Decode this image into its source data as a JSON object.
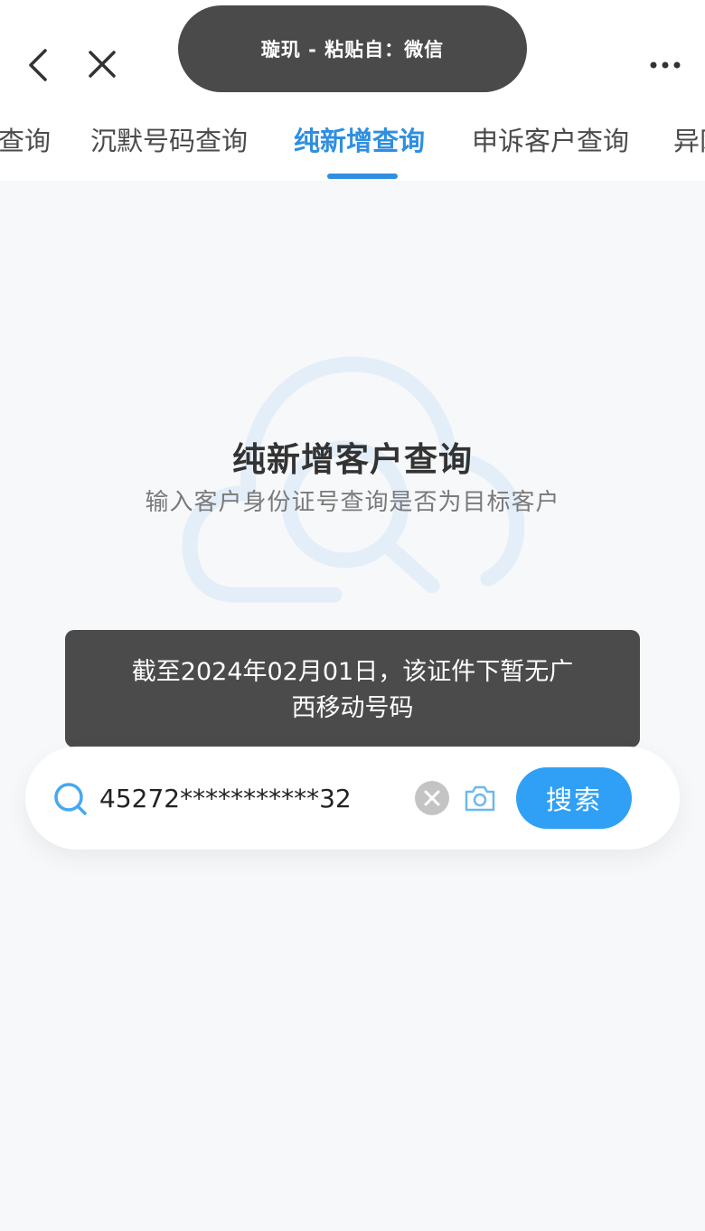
{
  "paste_toast": {
    "text": "璇玑 - 粘贴自：微信"
  },
  "nav": {
    "back_icon": "chevron-left-icon",
    "close_icon": "close-icon",
    "more_icon": "more-horizontal-icon"
  },
  "tabs": [
    {
      "label": "查询",
      "active": false
    },
    {
      "label": "沉默号码查询",
      "active": false
    },
    {
      "label": "纯新增查询",
      "active": true
    },
    {
      "label": "申诉客户查询",
      "active": false
    },
    {
      "label": "异网",
      "active": false
    }
  ],
  "hero": {
    "title": "纯新增客户查询",
    "subtitle": "输入客户身份证号查询是否为目标客户",
    "illustration_icon": "cloud-search-icon"
  },
  "result_toast": {
    "line1": "截至2024年02月01日，该证件下暂无广",
    "line2": "西移动号码"
  },
  "search": {
    "value": "45272***********32",
    "button_label": "搜索",
    "icons": [
      "search-icon",
      "clear-icon",
      "camera-icon"
    ]
  },
  "colors": {
    "accent": "#2f8fe0",
    "button": "#2fa0f5",
    "toast_bg": "#4b4b4b",
    "page_bg": "#f7f8fa"
  }
}
